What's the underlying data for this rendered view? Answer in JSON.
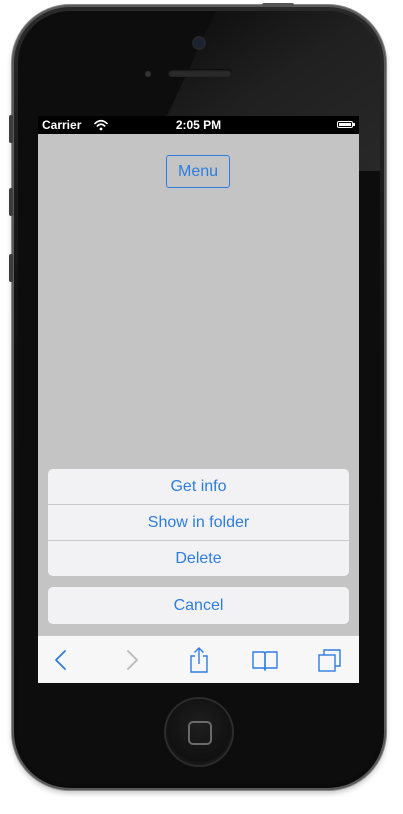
{
  "status_bar": {
    "carrier": "Carrier",
    "time": "2:05 PM",
    "wifi_icon": "wifi-icon",
    "battery_icon": "battery-icon"
  },
  "page": {
    "menu_label": "Menu"
  },
  "action_sheet": {
    "items": [
      {
        "label": "Get info"
      },
      {
        "label": "Show in folder"
      },
      {
        "label": "Delete"
      }
    ],
    "cancel_label": "Cancel"
  },
  "toolbar": {
    "icons": [
      "back-icon",
      "forward-icon",
      "share-icon",
      "bookmarks-icon",
      "tabs-icon"
    ]
  },
  "colors": {
    "accent": "#2d7de0",
    "screen_background": "#c4c4c4",
    "sheet_background": "#f2f2f4",
    "toolbar_background": "#f7f7f8"
  }
}
